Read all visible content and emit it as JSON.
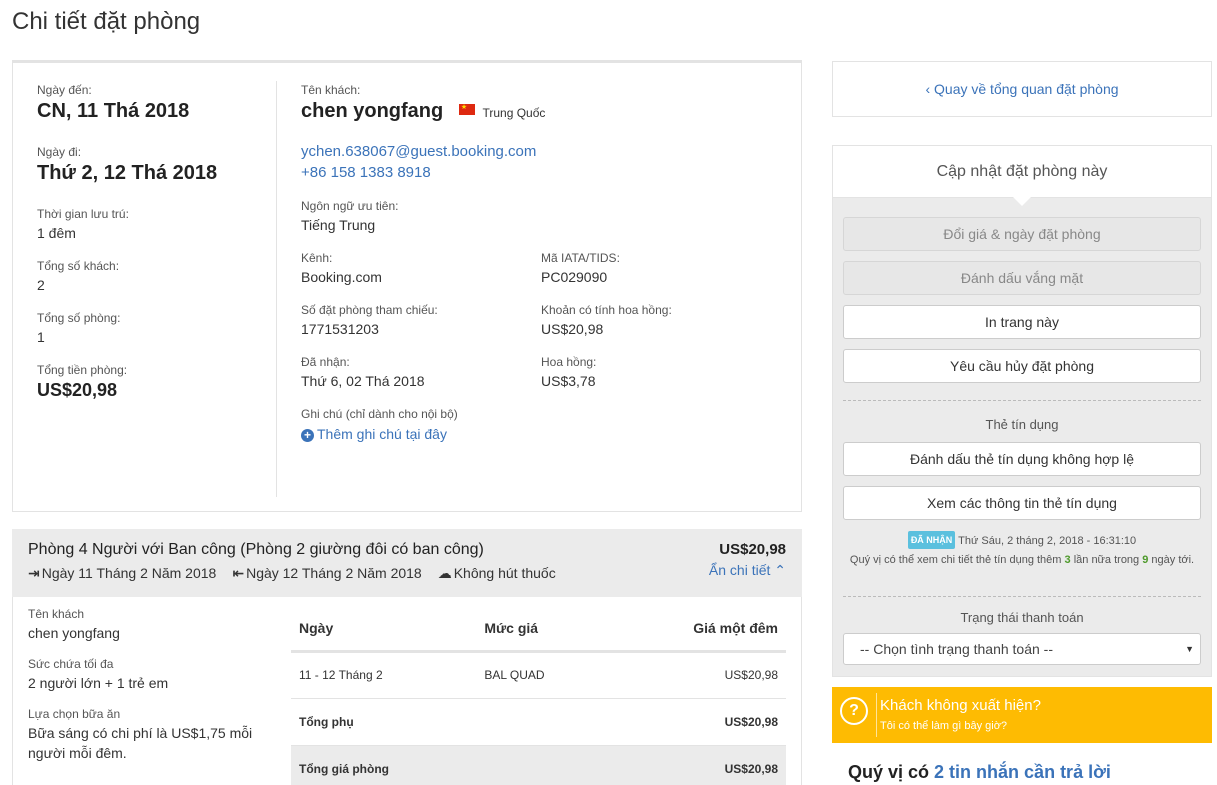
{
  "page_title": "Chi tiết đặt phòng",
  "summary": {
    "arrival_label": "Ngày đến:",
    "arrival_value": "CN, 11 Thá 2018",
    "departure_label": "Ngày đi:",
    "departure_value": "Thứ 2, 12 Thá 2018",
    "stay_label": "Thời gian lưu trú:",
    "stay_value": "1 đêm",
    "guests_label": "Tổng số khách:",
    "guests_value": "2",
    "rooms_label": "Tổng số phòng:",
    "rooms_value": "1",
    "total_label": "Tổng tiền phòng:",
    "total_value": "US$20,98"
  },
  "guest": {
    "name_label": "Tên khách:",
    "name": "chen yongfang",
    "country": "Trung Quốc",
    "email": "ychen.638067@guest.booking.com",
    "phone": "+86 158 1383 8918",
    "language_label": "Ngôn ngữ ưu tiên:",
    "language": "Tiếng Trung",
    "channel_label": "Kênh:",
    "channel": "Booking.com",
    "iata_label": "Mã IATA/TIDS:",
    "iata": "PC029090",
    "ref_label": "Số đặt phòng tham chiếu:",
    "ref": "1771531203",
    "commissionable_label": "Khoản có tính hoa hồng:",
    "commissionable": "US$20,98",
    "received_label": "Đã nhận:",
    "received": "Thứ 6, 02 Thá 2018",
    "commission_label": "Hoa hồng:",
    "commission": "US$3,78",
    "note_label": "Ghi chú (chỉ dành cho nội bộ)",
    "add_note": "Thêm ghi chú tại đây"
  },
  "room": {
    "title": "Phòng 4 Người với Ban công (Phòng 2 giường đôi có ban công)",
    "price": "US$20,98",
    "checkin": "Ngày 11 Tháng 2 Năm 2018",
    "checkout": "Ngày 12 Tháng 2 Năm 2018",
    "smoking": "Không hút thuốc",
    "hide_details": "Ẩn chi tiết",
    "guest_name_label": "Tên khách",
    "guest_name": "chen yongfang",
    "capacity_label": "Sức chứa tối đa",
    "capacity": "2 người lớn + 1 trẻ em",
    "meal_label": "Lựa chọn bữa ăn",
    "meal": "Bữa sáng có chi phí là US$1,75 mỗi người mỗi đêm.",
    "table": {
      "headers": [
        "Ngày",
        "Mức giá",
        "Giá một đêm"
      ],
      "row": [
        "11 - 12 Tháng 2",
        "BAL QUAD",
        "US$20,98"
      ],
      "subtotal_label": "Tổng phụ",
      "subtotal": "US$20,98",
      "total_label": "Tổng giá phòng",
      "total": "US$20,98"
    }
  },
  "sidebar": {
    "back_link": "Quay về tổng quan đặt phòng",
    "update_title": "Cập nhật đặt phòng này",
    "btn_change_price": "Đổi giá & ngày đặt phòng",
    "btn_no_show": "Đánh dấu vắng mặt",
    "btn_print": "In trang này",
    "btn_cancel": "Yêu cầu hủy đặt phòng",
    "credit_card_label": "Thẻ tín dụng",
    "btn_invalid_card": "Đánh dấu thẻ tín dụng không hợp lệ",
    "btn_view_card": "Xem các thông tin thẻ tín dụng",
    "received_badge": "ĐÃ NHẬN",
    "received_time": "Thứ Sáu, 2 tháng 2, 2018 - 16:31:10",
    "cc_note_pre": "Quý vị có thể xem chi tiết thẻ tín dụng thêm",
    "cc_times": "3",
    "cc_note_mid": "lần nữa trong",
    "cc_days": "9",
    "cc_note_post": "ngày tới.",
    "payment_status_label": "Trạng thái thanh toán",
    "payment_select": "-- Chọn tình trạng thanh toán --",
    "noshow_title": "Khách không xuất hiện?",
    "noshow_sub": "Tôi có thể làm gì bây giờ?",
    "messages_pre": "Quý vị có",
    "messages_link": "2 tin nhắn cần trả lời"
  },
  "colors": {
    "link_blue": "#3b73b9",
    "noshow_yellow": "#febb02",
    "badge_blue": "#5bc0de",
    "count_green": "#4e9a2b"
  }
}
